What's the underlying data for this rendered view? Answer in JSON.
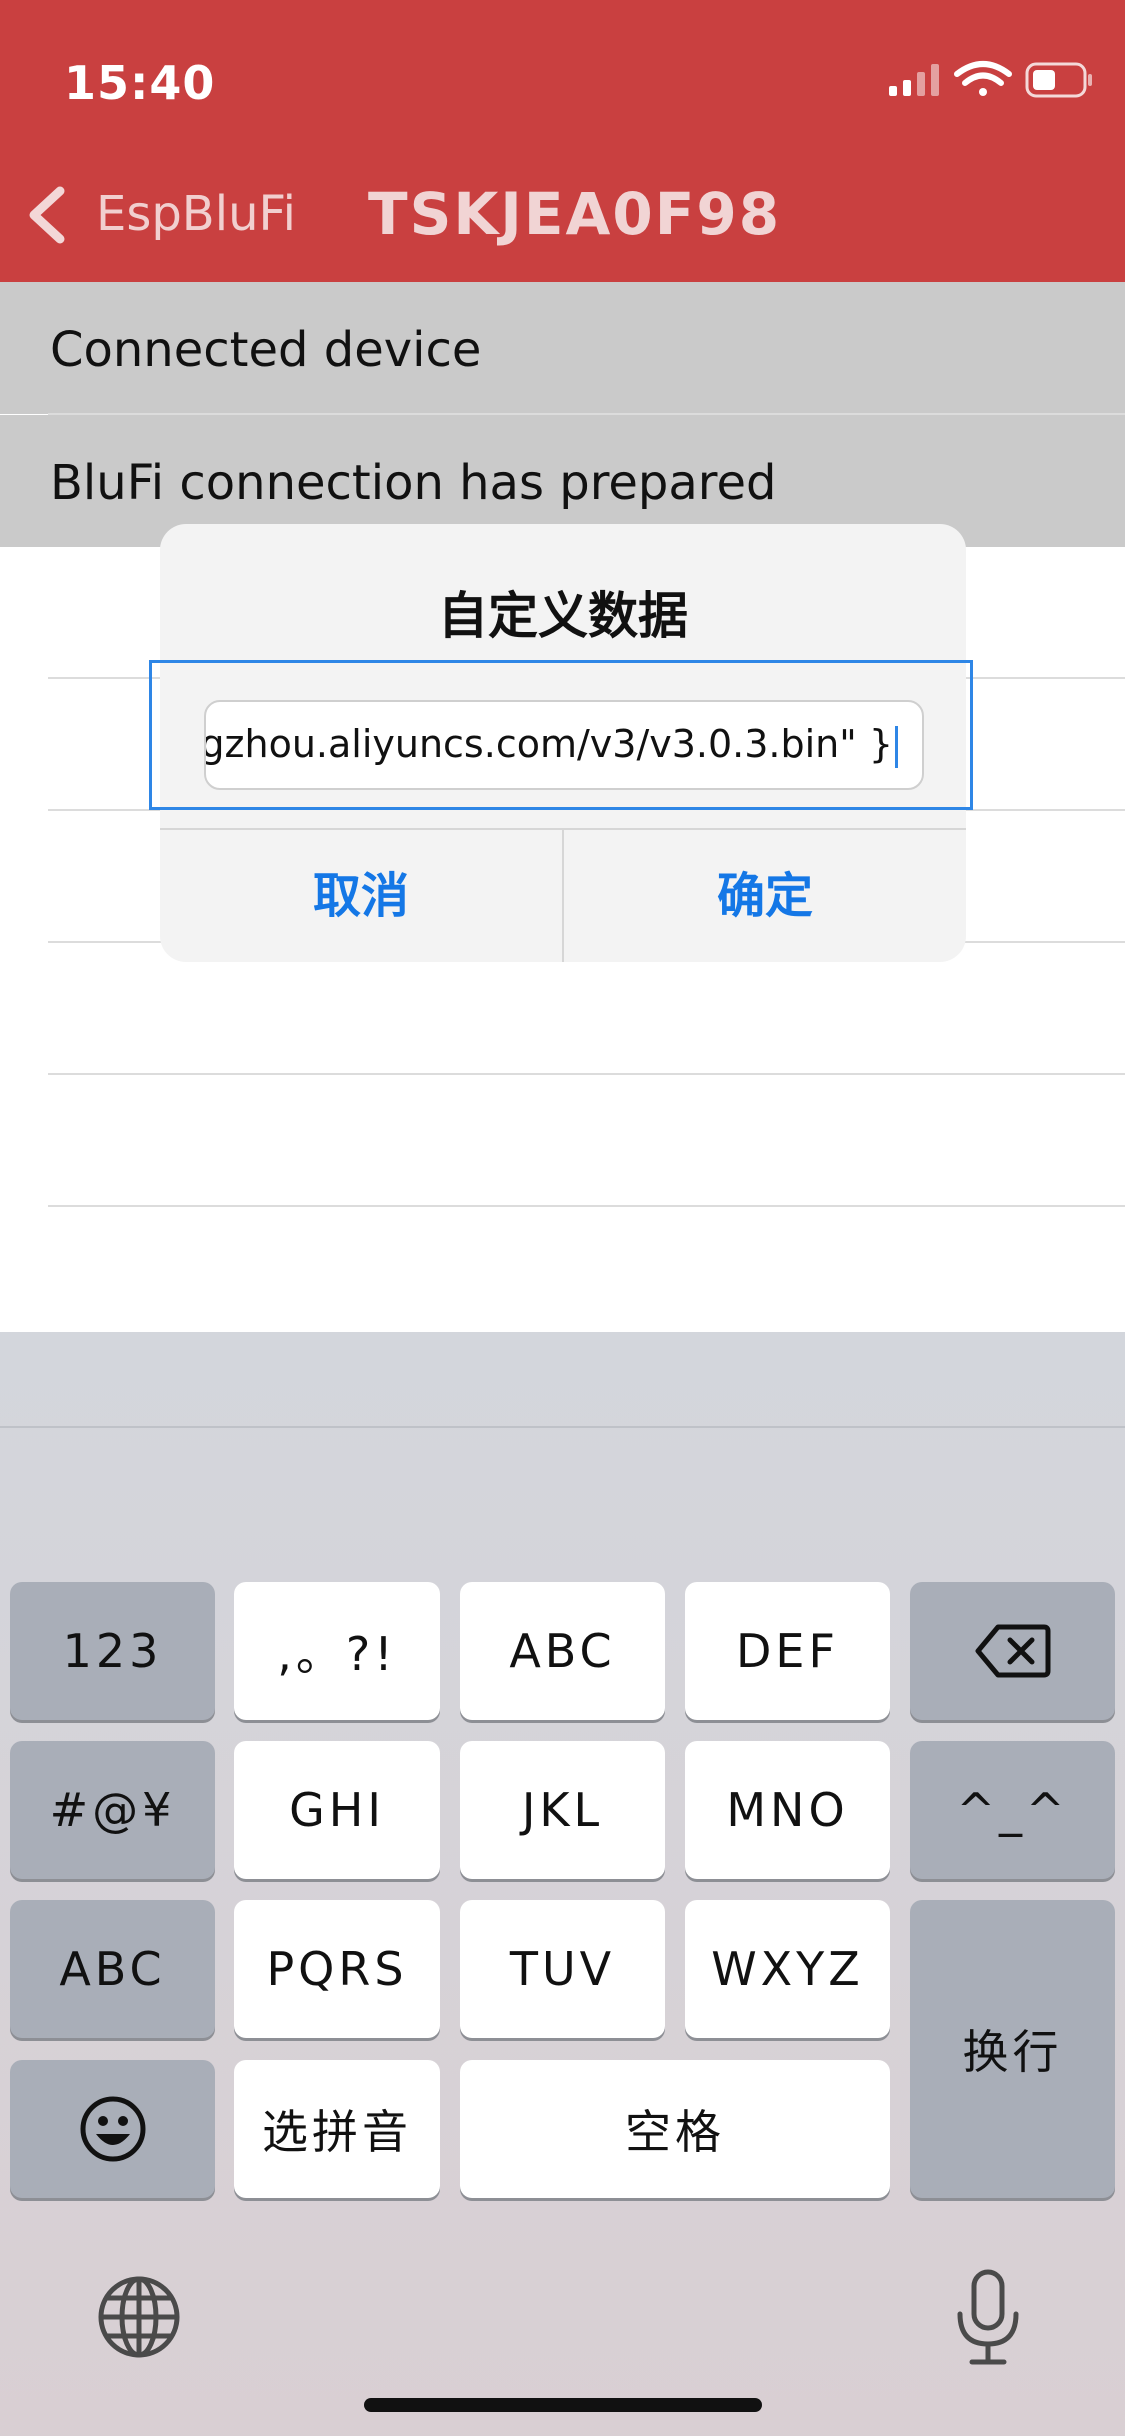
{
  "status_bar": {
    "time": "15:40"
  },
  "nav": {
    "back_label": "EspBluFi",
    "title": "TSKJEA0F98"
  },
  "list": {
    "items": [
      "Connected device",
      "BluFi connection has prepared"
    ]
  },
  "dialog": {
    "title": "自定义数据",
    "input_value": "gzhou.aliyuncs.com/v3/v3.0.3.bin\" }",
    "cancel_label": "取消",
    "confirm_label": "确定"
  },
  "keyboard": {
    "keys": {
      "numbers": "123",
      "punct": ",。?!",
      "abc": "ABC",
      "def": "DEF",
      "symbols": "#@¥",
      "ghi": "GHI",
      "jkl": "JKL",
      "mno": "MNO",
      "emoticon": "^_^",
      "abc_mode": "ABC",
      "pqrs": "PQRS",
      "tuv": "TUV",
      "wxyz": "WXYZ",
      "return": "换行",
      "pinyin": "选拼音",
      "space": "空格"
    },
    "icons": [
      "delete-icon",
      "emoji-icon",
      "globe-icon",
      "microphone-icon"
    ]
  },
  "colors": {
    "header": "#C94040",
    "accent": "#1477E6",
    "list_highlight": "#CACACA"
  }
}
